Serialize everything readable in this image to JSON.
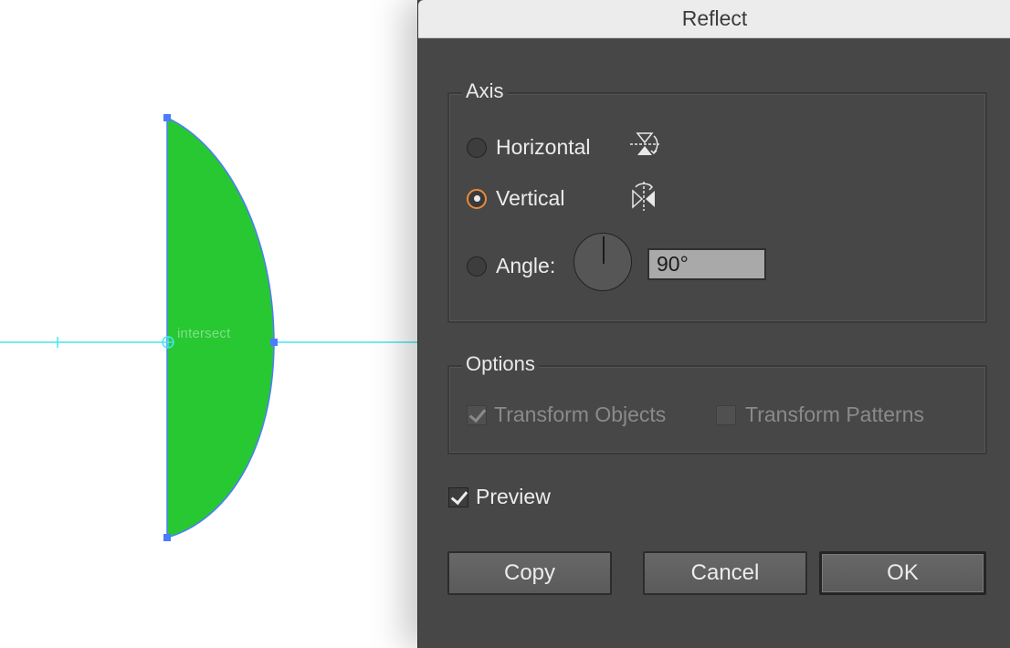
{
  "canvas": {
    "smart_guide_label": "intersect",
    "shape_fill": "#28c832",
    "path_stroke": "#4d7bff",
    "guide_color": "#49e6ef"
  },
  "dialog": {
    "title": "Reflect",
    "axis": {
      "legend": "Axis",
      "options": [
        {
          "label": "Horizontal",
          "icon": "reflect-horizontal-icon",
          "selected": false
        },
        {
          "label": "Vertical",
          "icon": "reflect-vertical-icon",
          "selected": true
        },
        {
          "label": "Angle:",
          "selected": false
        }
      ],
      "angle_value": "90°"
    },
    "options": {
      "legend": "Options",
      "transform_objects": {
        "label": "Transform Objects",
        "checked": true,
        "enabled": false
      },
      "transform_patterns": {
        "label": "Transform Patterns",
        "checked": false,
        "enabled": false
      }
    },
    "preview": {
      "label": "Preview",
      "checked": true
    },
    "buttons": {
      "copy": "Copy",
      "cancel": "Cancel",
      "ok": "OK"
    },
    "accent_color": "#e98b3e"
  }
}
